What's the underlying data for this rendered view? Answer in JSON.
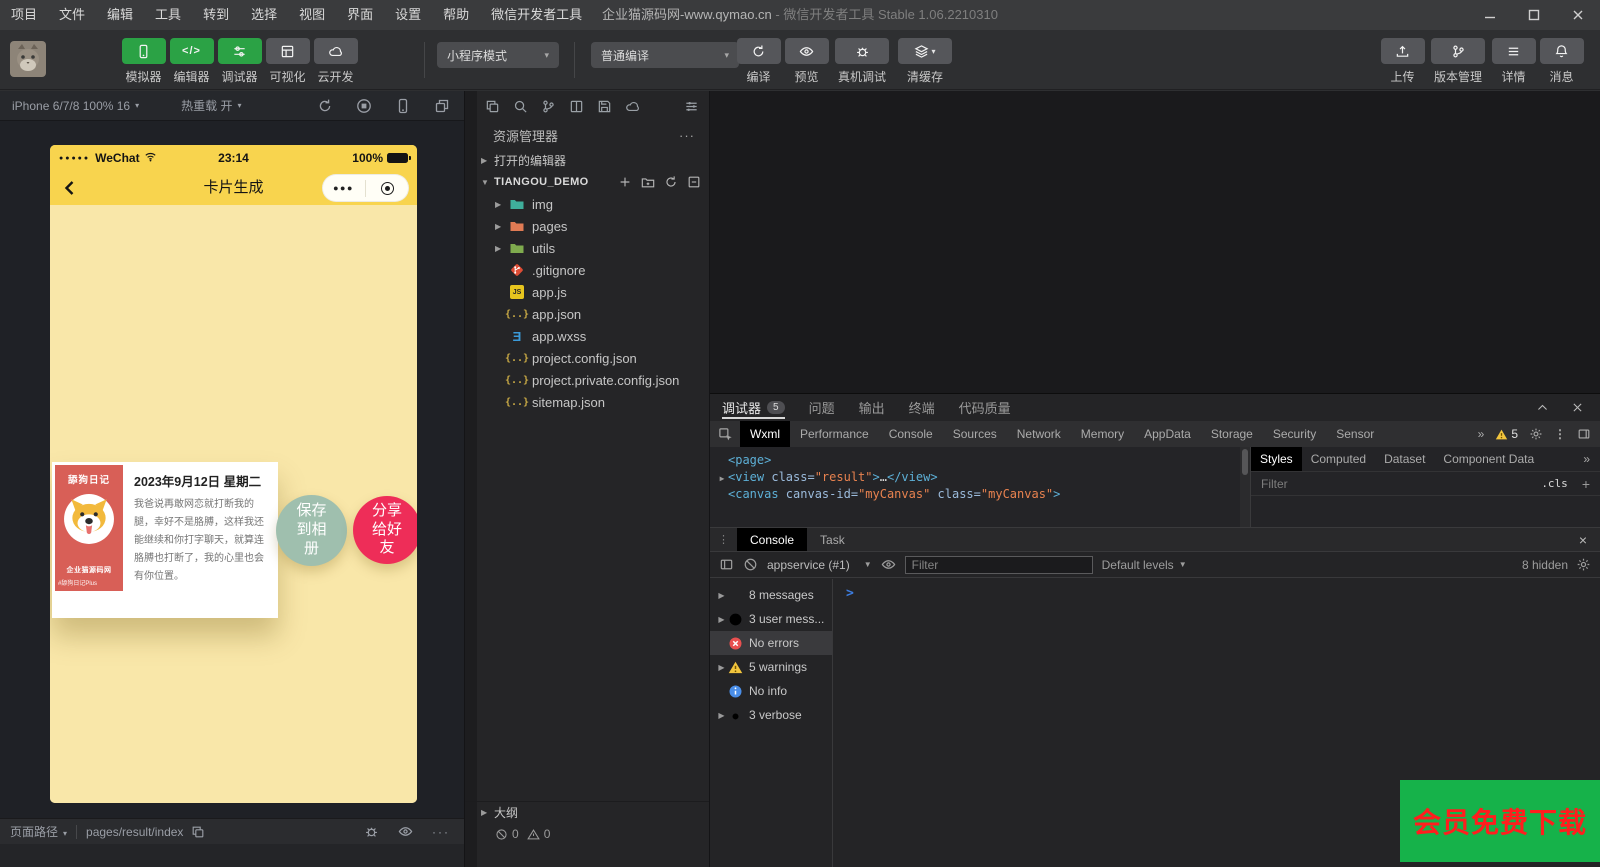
{
  "colors": {
    "accent_green": "#2ba245",
    "phone_yellow": "#f8d44e",
    "page_yellow": "#f9e7a9",
    "card_red": "#d85f57",
    "save_green": "#9fbfae",
    "share_pink": "#ee2d58",
    "promo_green": "#16b24a",
    "promo_red": "#ff1e1e"
  },
  "window": {
    "menu": [
      "项目",
      "文件",
      "编辑",
      "工具",
      "转到",
      "选择",
      "视图",
      "界面",
      "设置",
      "帮助",
      "微信开发者工具"
    ],
    "title_project": "企业猫源码网-www.qymao.cn",
    "title_app": "- 微信开发者工具 Stable 1.06.2210310"
  },
  "toolbar": {
    "modes": [
      {
        "label": "模拟器",
        "icon": "phone",
        "active": true
      },
      {
        "label": "编辑器",
        "icon": "code",
        "active": true
      },
      {
        "label": "调试器",
        "icon": "sliders",
        "active": true
      },
      {
        "label": "可视化",
        "icon": "grid",
        "active": false
      },
      {
        "label": "云开发",
        "icon": "cloud",
        "active": false
      }
    ],
    "mode_select": "小程序模式",
    "compile_select": "普通编译",
    "actions": [
      {
        "label": "编译",
        "icon": "refresh"
      },
      {
        "label": "预览",
        "icon": "eye"
      },
      {
        "label": "真机调试",
        "icon": "bug",
        "wide": true
      },
      {
        "label": "清缓存",
        "icon": "layers",
        "caret": true,
        "wide": true
      }
    ],
    "right_actions": [
      {
        "label": "上传",
        "icon": "upload"
      },
      {
        "label": "版本管理",
        "icon": "branch",
        "wide": true
      },
      {
        "label": "详情",
        "icon": "hamburger"
      },
      {
        "label": "消息",
        "icon": "bell"
      }
    ]
  },
  "simulator": {
    "device": "iPhone 6/7/8 100% 16",
    "hot_reload": "热重载 开",
    "statusbar": {
      "path_label": "页面路径",
      "path": "pages/result/index"
    }
  },
  "phone": {
    "carrier": "WeChat",
    "time": "23:14",
    "battery": "100%",
    "nav_title": "卡片生成",
    "card": {
      "ribbon_title": "舔狗日记",
      "brand": "企业猫源码网",
      "watermark": "#舔狗日记Plus",
      "date": "2023年9月12日 星期二",
      "body": "我爸说再敢网恋就打断我的腿，幸好不是胳膊，这样我还能继续和你打字聊天，就算连胳膊也打断了，我的心里也会有你位置。"
    },
    "save_button": "保存到相册",
    "share_button": "分享给好友"
  },
  "explorer": {
    "title": "资源管理器",
    "more": "···",
    "open_editors": "打开的编辑器",
    "project": "TIANGOU_DEMO",
    "files": [
      {
        "name": "img",
        "type": "folder",
        "color": "#3fae9b",
        "expandable": true
      },
      {
        "name": "pages",
        "type": "folder",
        "color": "#e07b54",
        "expandable": true
      },
      {
        "name": "utils",
        "type": "folder",
        "color": "#7fab4e",
        "expandable": true
      },
      {
        "name": ".gitignore",
        "type": "git"
      },
      {
        "name": "app.js",
        "type": "js"
      },
      {
        "name": "app.json",
        "type": "json"
      },
      {
        "name": "app.wxss",
        "type": "wxss"
      },
      {
        "name": "project.config.json",
        "type": "json"
      },
      {
        "name": "project.private.config.json",
        "type": "json"
      },
      {
        "name": "sitemap.json",
        "type": "json"
      }
    ],
    "outline": "大纲",
    "errors": "0",
    "warnings": "0"
  },
  "debug": {
    "panel_tabs": [
      {
        "label": "调试器",
        "badge": "5",
        "active": true
      },
      {
        "label": "问题"
      },
      {
        "label": "输出"
      },
      {
        "label": "终端"
      },
      {
        "label": "代码质量"
      }
    ],
    "devtools_tabs": [
      {
        "label": "Wxml",
        "active": true
      },
      {
        "label": "Performance"
      },
      {
        "label": "Console"
      },
      {
        "label": "Sources"
      },
      {
        "label": "Network"
      },
      {
        "label": "Memory"
      },
      {
        "label": "AppData"
      },
      {
        "label": "Storage"
      },
      {
        "label": "Security"
      },
      {
        "label": "Sensor"
      }
    ],
    "more_tabs": "»",
    "warn_badge": "5",
    "code": [
      {
        "tokens": [
          [
            "tag",
            "<page>"
          ]
        ]
      },
      {
        "arrow": true,
        "tokens": [
          [
            "tag",
            "<view"
          ],
          [
            "attr",
            " class="
          ],
          [
            "str",
            "\"result\""
          ],
          [
            "tag",
            ">"
          ],
          [
            "plain",
            "…"
          ],
          [
            "tag",
            "</view>"
          ]
        ]
      },
      {
        "tokens": [
          [
            "tag",
            "<canvas"
          ],
          [
            "attr",
            " canvas-id="
          ],
          [
            "str",
            "\"myCanvas\""
          ],
          [
            "attr",
            " class="
          ],
          [
            "str",
            "\"myCanvas\""
          ],
          [
            "tag",
            ">"
          ]
        ]
      }
    ],
    "styles_tabs": [
      {
        "label": "Styles",
        "active": true
      },
      {
        "label": "Computed"
      },
      {
        "label": "Dataset"
      },
      {
        "label": "Component Data"
      }
    ],
    "styles_more": "»",
    "filter_label": "Filter",
    "cls_label": ".cls",
    "collapse_glyph": "^",
    "close_glyph": "×"
  },
  "console": {
    "tabs": [
      {
        "label": "Console",
        "active": true
      },
      {
        "label": "Task"
      }
    ],
    "context": "appservice (#1)",
    "filter_placeholder": "Filter",
    "levels": "Default levels",
    "hidden": "8 hidden",
    "prompt": ">",
    "close_glyph": "×",
    "items": [
      {
        "label": "8 messages",
        "icon": "list",
        "expandable": true
      },
      {
        "label": "3 user mess...",
        "icon": "user",
        "expandable": true
      },
      {
        "label": "No errors",
        "icon": "error",
        "selected": true
      },
      {
        "label": "5 warnings",
        "icon": "warning",
        "expandable": true
      },
      {
        "label": "No info",
        "icon": "info"
      },
      {
        "label": "3 verbose",
        "icon": "verbose",
        "expandable": true
      }
    ]
  },
  "promo": {
    "text": "会员免费下载"
  }
}
